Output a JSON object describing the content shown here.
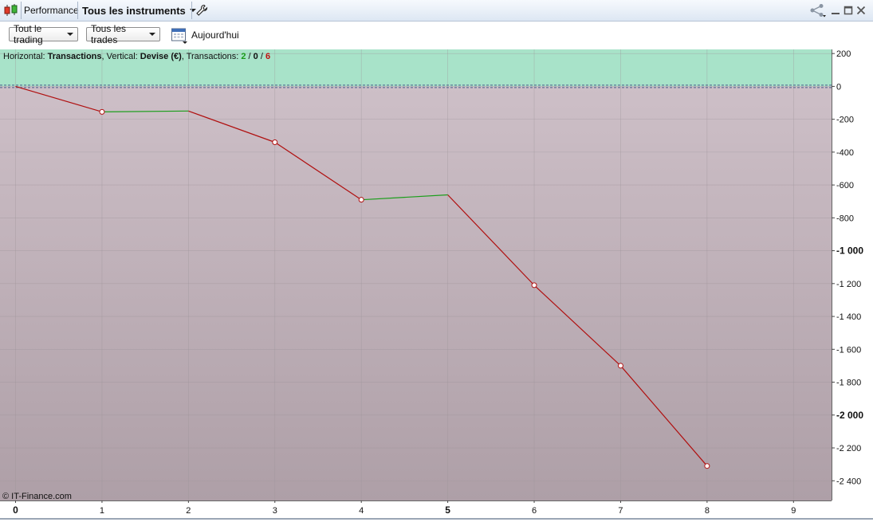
{
  "titlebar": {
    "tab_performance": "Performance",
    "instrument_selector": "Tous les instruments"
  },
  "toolbar": {
    "scope_dropdown": "Tout le trading",
    "trades_dropdown": "Tous les trades",
    "period_label": "Aujourd'hui"
  },
  "chart_info": {
    "horizontal_prefix": "Horizontal: ",
    "horizontal_value": "Transactions",
    "vertical_prefix": ", Vertical: ",
    "vertical_value": "Devise (€)",
    "transactions_prefix": ", Transactions: ",
    "wins": "2",
    "sep1": " / ",
    "neutral": "0",
    "sep2": " / ",
    "losses": "6"
  },
  "copyright": "© IT-Finance.com",
  "colors": {
    "positive_zone": "#a8e3c9",
    "negative_zone_top": "#cdbfc7",
    "negative_zone_bottom": "#ae9fa7",
    "loss_line": "#b01010",
    "win_line": "#1b9e1b",
    "win_text": "#1a9a1a",
    "loss_text": "#c01010"
  },
  "chart_data": {
    "type": "line",
    "title": "",
    "xlabel": "",
    "ylabel": "",
    "x": [
      0,
      1,
      2,
      3,
      4,
      5,
      6,
      7,
      8
    ],
    "y": [
      0,
      -155,
      -150,
      -340,
      -690,
      -660,
      -1210,
      -1700,
      -2310
    ],
    "markers": [
      false,
      true,
      false,
      true,
      true,
      false,
      true,
      true,
      true
    ],
    "segment_result": [
      "loss",
      "win",
      "loss",
      "loss",
      "win",
      "loss",
      "loss",
      "loss"
    ],
    "xticks": [
      "0",
      "1",
      "2",
      "3",
      "4",
      "5",
      "6",
      "7",
      "8",
      "9"
    ],
    "xticks_bold": [
      "0",
      "5"
    ],
    "yticks": [
      {
        "v": 200,
        "label": "200"
      },
      {
        "v": 0,
        "label": "0"
      },
      {
        "v": -200,
        "label": "-200"
      },
      {
        "v": -400,
        "label": "-400"
      },
      {
        "v": -600,
        "label": "-600"
      },
      {
        "v": -800,
        "label": "-800"
      },
      {
        "v": -1000,
        "label": "-1 000"
      },
      {
        "v": -1200,
        "label": "-1 200"
      },
      {
        "v": -1400,
        "label": "-1 400"
      },
      {
        "v": -1600,
        "label": "-1 600"
      },
      {
        "v": -1800,
        "label": "-1 800"
      },
      {
        "v": -2000,
        "label": "-2 000"
      },
      {
        "v": -2200,
        "label": "-2 200"
      },
      {
        "v": -2400,
        "label": "-2 400"
      }
    ],
    "yticks_bold": [
      "-1 000",
      "-2 000"
    ],
    "xlim": [
      -0.18,
      9.44
    ],
    "ylim": [
      -2520,
      225
    ],
    "grid": true,
    "legend": "none"
  }
}
